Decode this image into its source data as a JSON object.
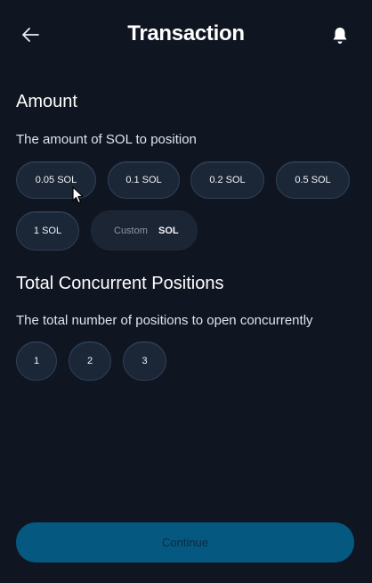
{
  "header": {
    "title": "Transaction",
    "back_icon": "arrow-left-icon",
    "notification_icon": "bell-icon"
  },
  "amount": {
    "title": "Amount",
    "description": "The amount of SOL to position",
    "options": [
      "0.05 SOL",
      "0.1 SOL",
      "0.2 SOL",
      "0.5 SOL",
      "1 SOL"
    ],
    "custom": {
      "placeholder": "Custom",
      "unit": "SOL"
    }
  },
  "positions": {
    "title": "Total Concurrent Positions",
    "description": "The total number of positions to open concurrently",
    "options": [
      "1",
      "2",
      "3"
    ]
  },
  "footer": {
    "continue_label": "Continue"
  },
  "colors": {
    "background": "#0f1521",
    "chip_background": "#1b2637",
    "chip_border": "#2f4157",
    "primary_button": "#05587f"
  }
}
